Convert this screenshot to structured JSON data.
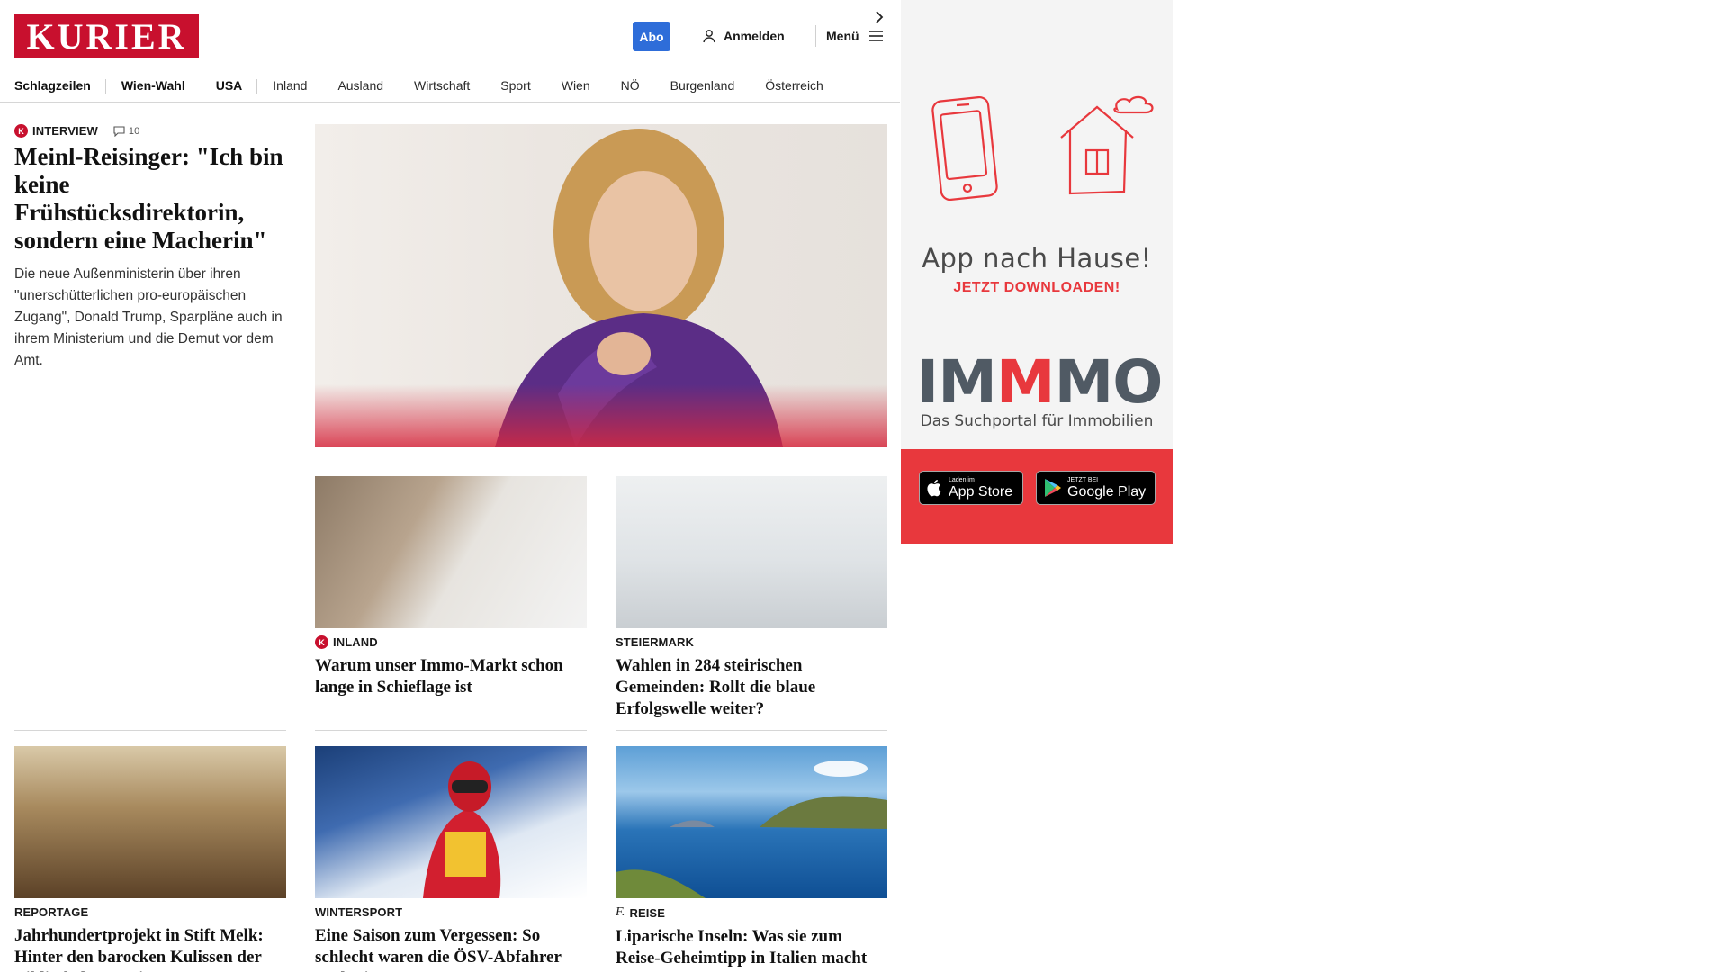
{
  "header": {
    "logo": "KURIER",
    "abo": "Abo",
    "login": "Anmelden",
    "menu": "Menü"
  },
  "nav": [
    {
      "label": "Schlagzeilen"
    },
    {
      "label": "Wien-Wahl"
    },
    {
      "label": "USA"
    },
    {
      "label": "Inland"
    },
    {
      "label": "Ausland"
    },
    {
      "label": "Wirtschaft"
    },
    {
      "label": "Sport"
    },
    {
      "label": "Wien"
    },
    {
      "label": "NÖ"
    },
    {
      "label": "Burgenland"
    },
    {
      "label": "Österreich"
    }
  ],
  "lead": {
    "kicker": "INTERVIEW",
    "comments": "10",
    "headline": "Meinl-Reisinger: \"Ich bin keine Frühstücksdirektorin, sondern eine Macherin\"",
    "text": "Die neue Außenministerin über ihren \"unerschütterlichen pro-europäischen Zugang\", Donald Trump, Sparpläne auch in ihrem Ministerium und die Demut vor dem Amt."
  },
  "cards": [
    {
      "kicker": "INLAND",
      "headline": "Warum unser Immo-Markt schon lange in Schieflage ist"
    },
    {
      "kicker": "STEIERMARK",
      "headline": "Wahlen in 284 steirischen Gemeinden: Rollt die blaue Erfolgswelle weiter?"
    },
    {
      "kicker": "REPORTAGE",
      "headline": "Jahrhundertprojekt in Stift Melk: Hinter den barocken Kulissen der Bibliotheksrenovierung"
    },
    {
      "kicker": "WINTERSPORT",
      "headline": "Eine Saison zum Vergessen: So schlecht waren die ÖSV-Abfahrer noch nie"
    },
    {
      "kicker": "REISE",
      "headline": "Liparische Inseln: Was sie zum Reise-Geheimtipp in Italien macht"
    }
  ],
  "ad": {
    "title": "App nach Hause!",
    "subtitle": "JETZT DOWNLOADEN!",
    "brand_a": "IM",
    "brand_m": "M",
    "brand_b": "MO",
    "tagline": "Das Suchportal für Immobilien",
    "appstore_small": "Laden im",
    "appstore_big": "App Store",
    "googleplay_small": "JETZT BEI",
    "googleplay_big": "Google Play"
  },
  "colors": {
    "brand_red": "#c8102e",
    "abo_blue": "#2e6dd9",
    "ad_red": "#e8383d"
  }
}
